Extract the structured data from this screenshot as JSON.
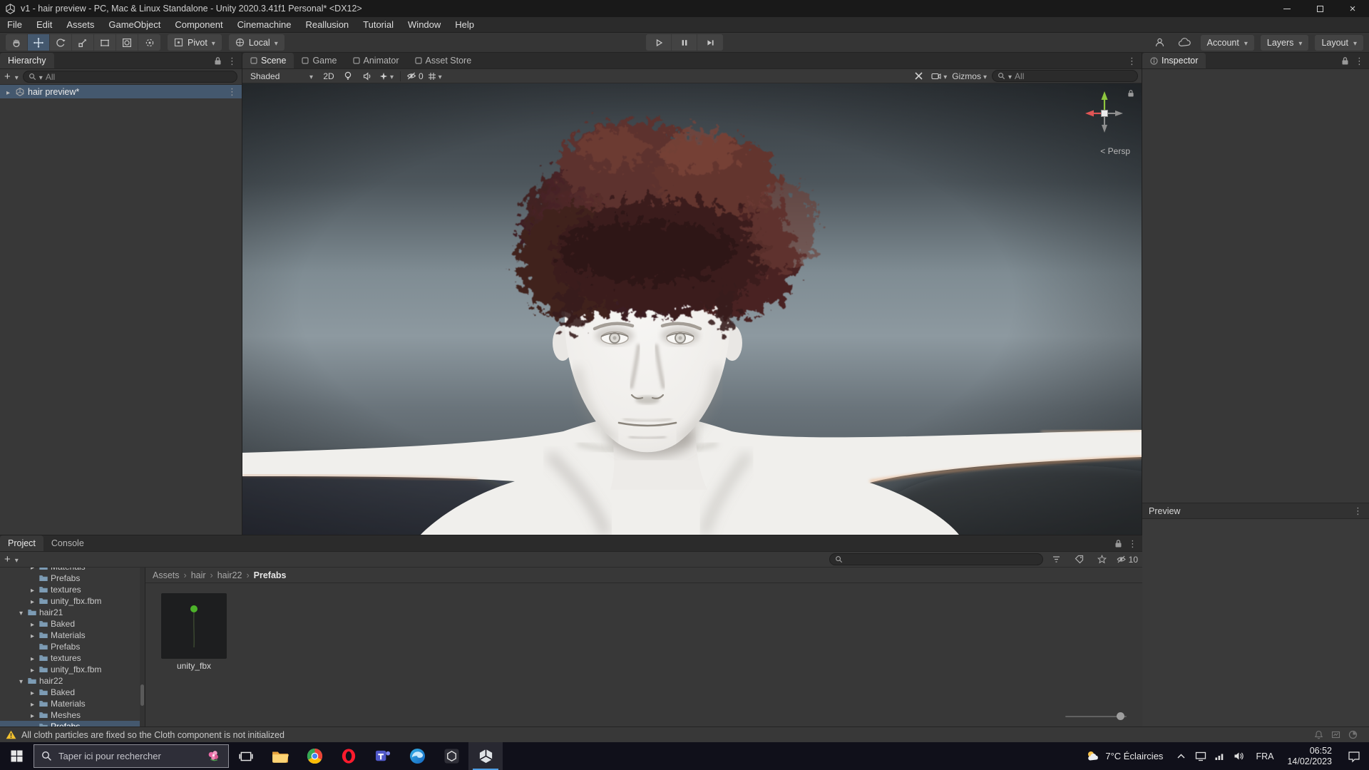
{
  "window": {
    "title": "v1 - hair preview - PC, Mac & Linux Standalone - Unity 2020.3.41f1 Personal* <DX12>"
  },
  "menubar": {
    "items": [
      {
        "label": "File"
      },
      {
        "label": "Edit"
      },
      {
        "label": "Assets"
      },
      {
        "label": "GameObject"
      },
      {
        "label": "Component"
      },
      {
        "label": "Cinemachine"
      },
      {
        "label": "Reallusion"
      },
      {
        "label": "Tutorial"
      },
      {
        "label": "Window"
      },
      {
        "label": "Help"
      }
    ]
  },
  "toolbar": {
    "pivot_label": "Pivot",
    "local_label": "Local",
    "account_label": "Account",
    "layers_label": "Layers",
    "layout_label": "Layout"
  },
  "hierarchy": {
    "tab_label": "Hierarchy",
    "search_placeholder": "All",
    "scene_row_label": "hair preview*"
  },
  "scene_view": {
    "tabs": [
      {
        "label": "Scene",
        "active": true
      },
      {
        "label": "Game"
      },
      {
        "label": "Animator"
      },
      {
        "label": "Asset Store"
      }
    ],
    "shading_mode": "Shaded",
    "toggle_2d_label": "2D",
    "visibility_hidden_count": "0",
    "gizmos_label": "Gizmos",
    "search_placeholder": "All",
    "projection_label": "< Persp"
  },
  "inspector": {
    "tab_label": "Inspector",
    "preview_label": "Preview"
  },
  "project": {
    "tabs": [
      {
        "label": "Project",
        "active": true
      },
      {
        "label": "Console"
      }
    ],
    "hidden_items_count": "10",
    "breadcrumb": [
      {
        "label": "Assets"
      },
      {
        "label": "hair"
      },
      {
        "label": "hair22"
      },
      {
        "label": "Prefabs",
        "current": true
      }
    ],
    "tree": [
      {
        "label": "Materials",
        "depth": 2,
        "collapsed": true,
        "partial": true
      },
      {
        "label": "Prefabs",
        "depth": 2
      },
      {
        "label": "textures",
        "depth": 2,
        "collapsed": true
      },
      {
        "label": "unity_fbx.fbm",
        "depth": 2,
        "collapsed": true
      },
      {
        "label": "hair21",
        "depth": 1,
        "expanded": true
      },
      {
        "label": "Baked",
        "depth": 2,
        "collapsed": true
      },
      {
        "label": "Materials",
        "depth": 2,
        "collapsed": true
      },
      {
        "label": "Prefabs",
        "depth": 2
      },
      {
        "label": "textures",
        "depth": 2,
        "collapsed": true
      },
      {
        "label": "unity_fbx.fbm",
        "depth": 2,
        "collapsed": true
      },
      {
        "label": "hair22",
        "depth": 1,
        "expanded": true
      },
      {
        "label": "Baked",
        "depth": 2,
        "collapsed": true
      },
      {
        "label": "Materials",
        "depth": 2,
        "collapsed": true
      },
      {
        "label": "Meshes",
        "depth": 2,
        "collapsed": true
      },
      {
        "label": "Prefabs",
        "depth": 2,
        "selected": true
      }
    ],
    "assets": [
      {
        "label": "unity_fbx"
      }
    ]
  },
  "status_bar": {
    "message": "All cloth particles are fixed so the Cloth component is not initialized"
  },
  "taskbar": {
    "search_placeholder": "Taper ici pour rechercher",
    "weather": "7°C Éclaircies",
    "language": "FRA",
    "time": "06:52",
    "date": "14/02/2023"
  },
  "colors": {
    "selection": "#44586e",
    "accent": "#4f9ee3",
    "warning": "#f2c12e"
  }
}
